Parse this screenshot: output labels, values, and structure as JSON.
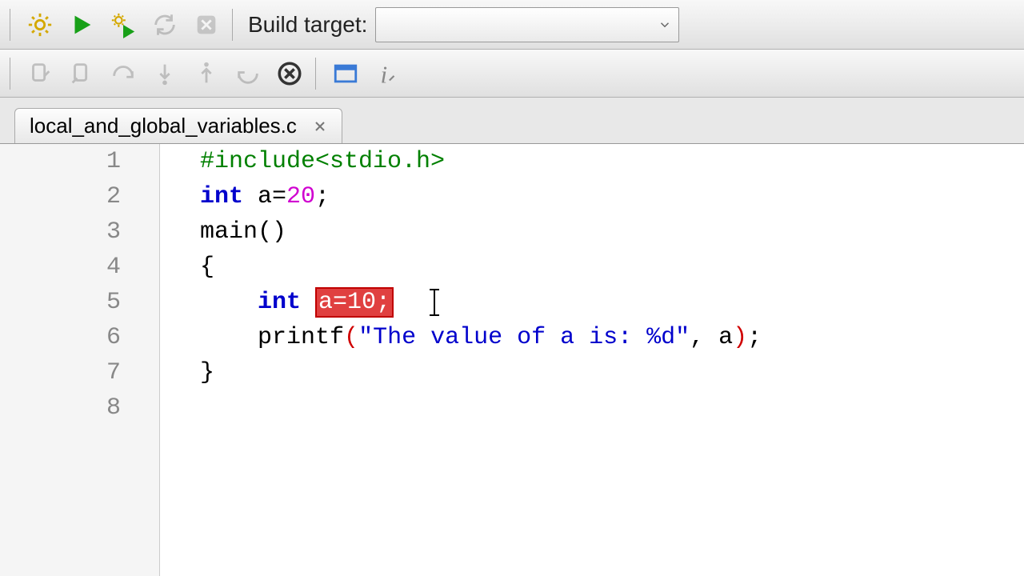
{
  "toolbar1": {
    "build_target_label": "Build target:"
  },
  "tab": {
    "filename": "local_and_global_variables.c"
  },
  "editor": {
    "line_numbers": [
      "1",
      "2",
      "3",
      "4",
      "5",
      "6",
      "7",
      "8"
    ],
    "lines": {
      "l1_include": "#include<stdio.h>",
      "l2_int": "int",
      "l2_var": " a=",
      "l2_num": "20",
      "l2_semi": ";",
      "l3_main": "main",
      "l3_paren": "()",
      "l4_brace": "{",
      "l5_int": "int",
      "l5_sel": "a=10;",
      "l6_printf": "printf",
      "l6_open": "(",
      "l6_str": "\"The value of a is: %d\"",
      "l6_rest": ", a",
      "l6_close": ")",
      "l6_semi": ";",
      "l7_brace": "}"
    }
  }
}
